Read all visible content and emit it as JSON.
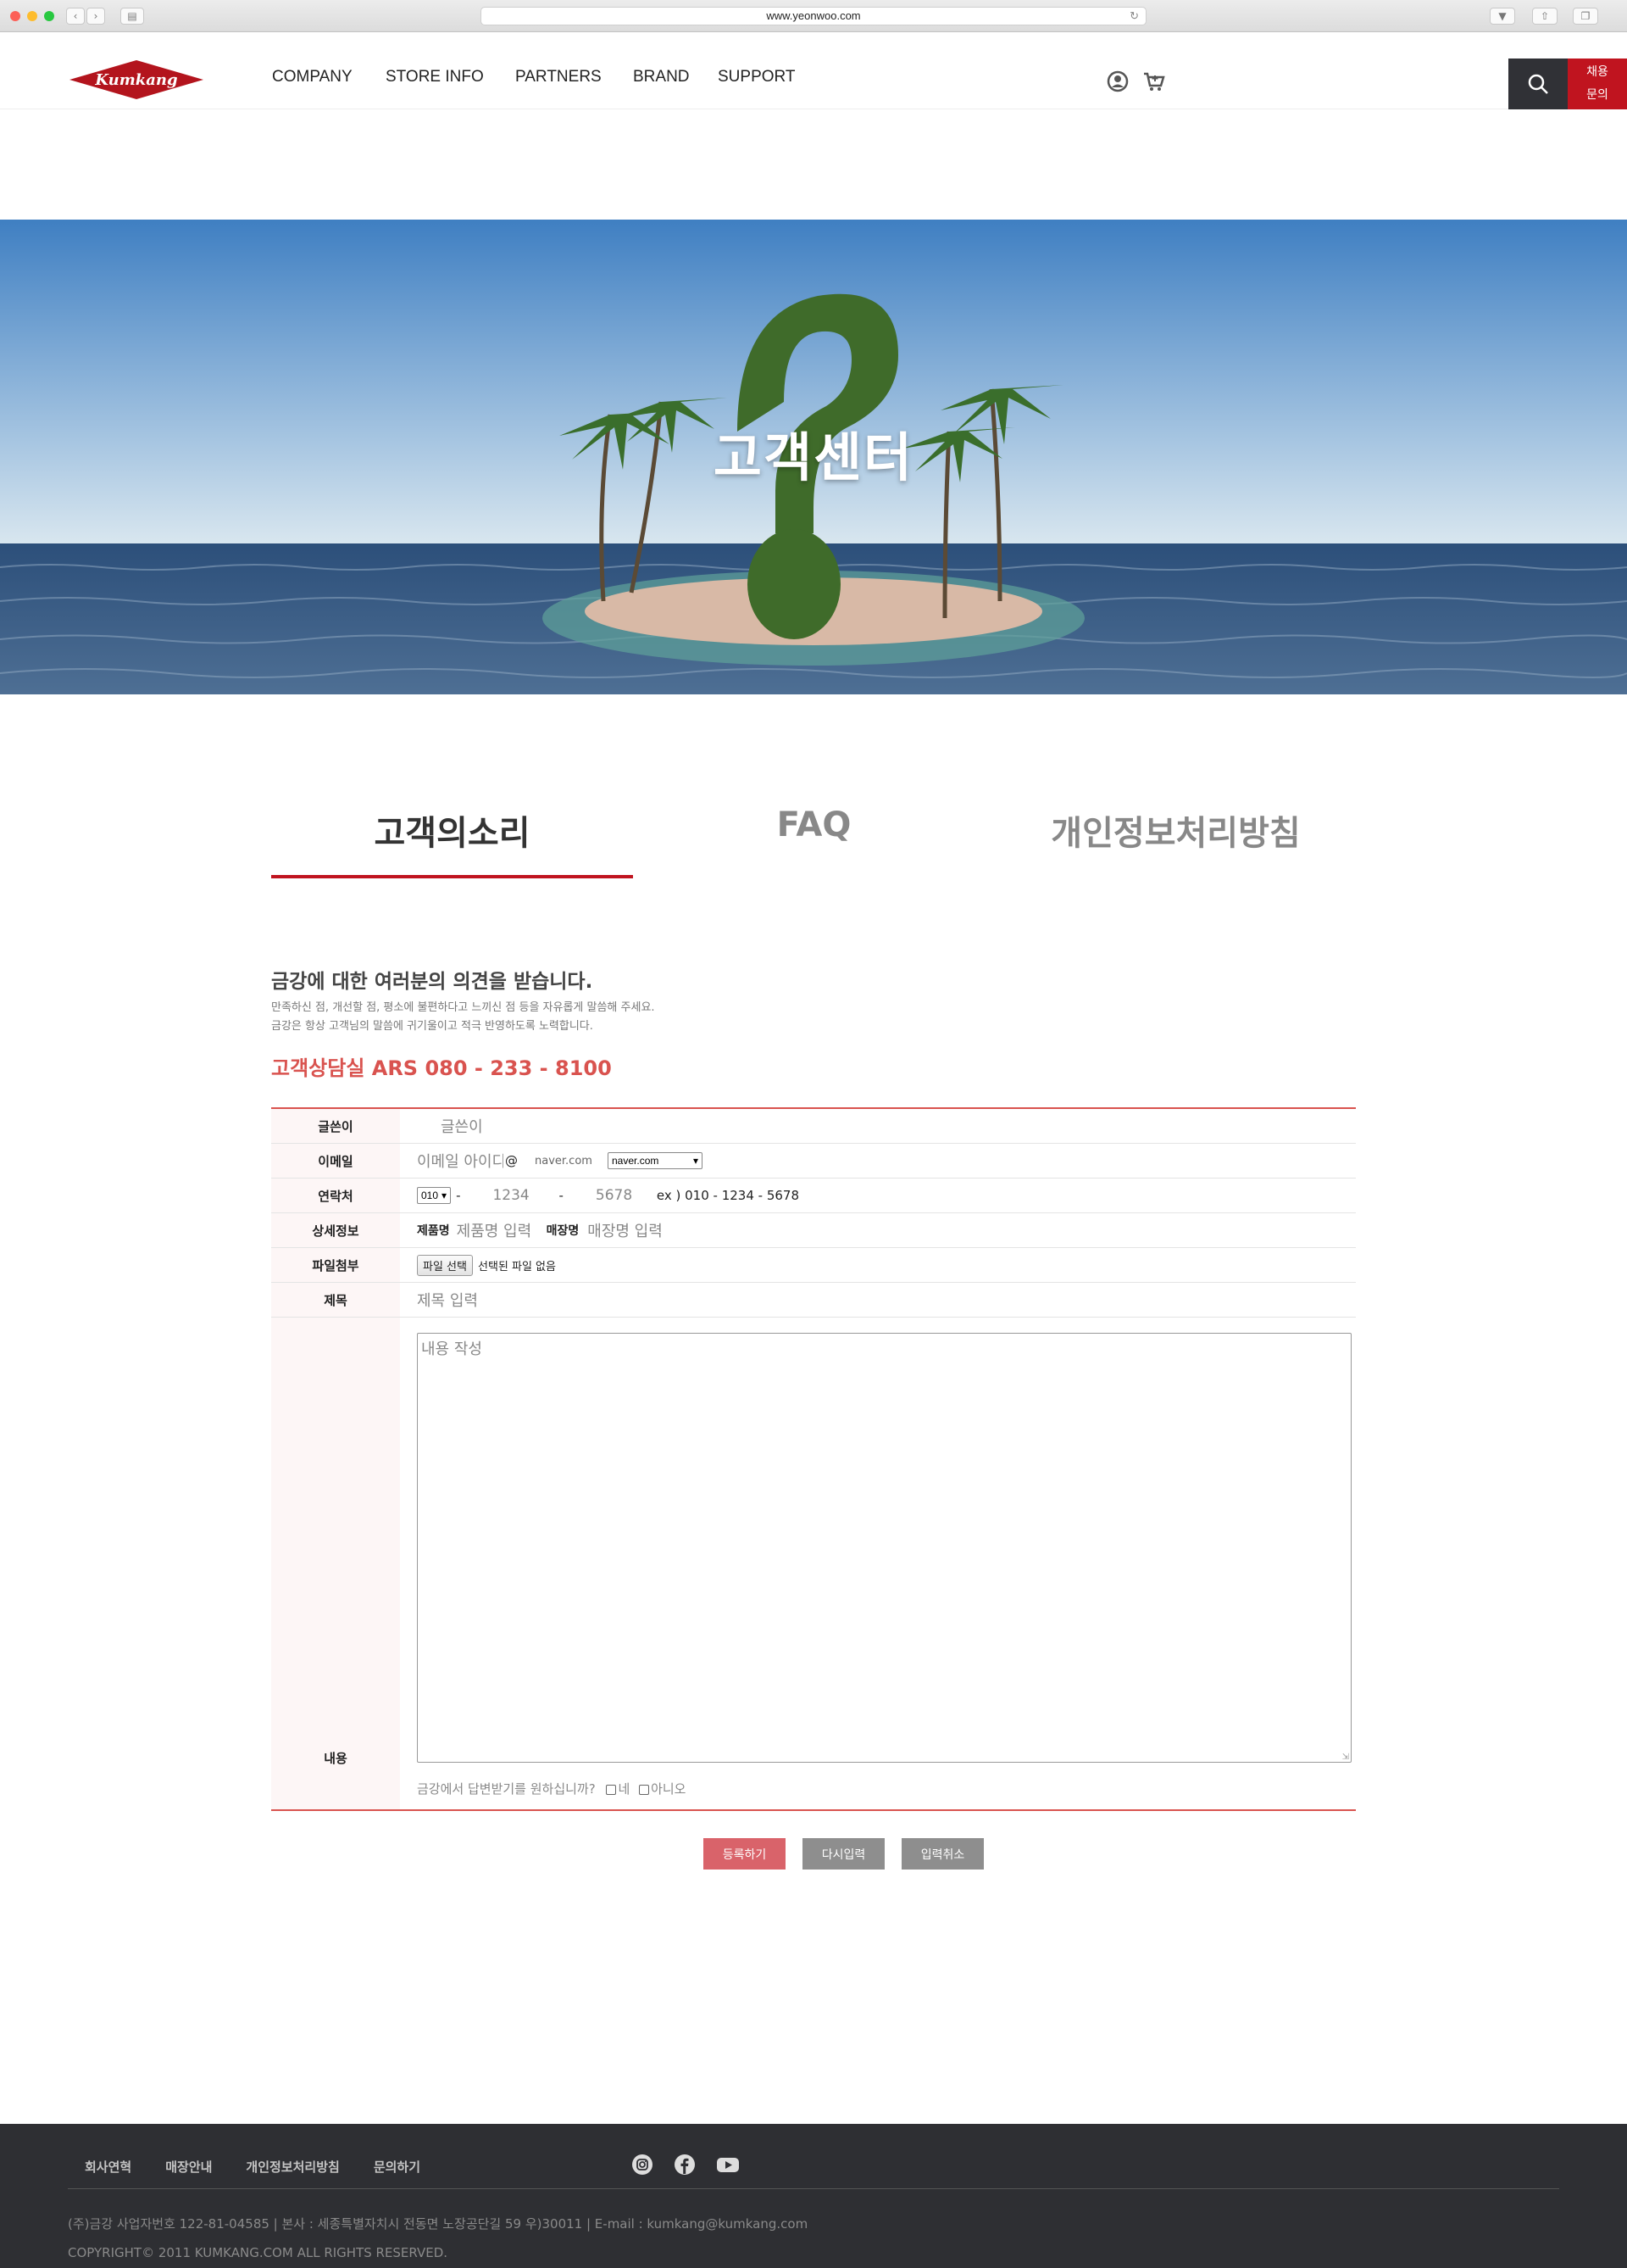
{
  "browser": {
    "url": "www.yeonwoo.com"
  },
  "header": {
    "logo_text": "Kumkang",
    "nav": [
      "COMPANY",
      "STORE INFO",
      "PARTNERS",
      "BRAND",
      "SUPPORT"
    ],
    "recruit_line1": "채용",
    "recruit_line2": "문의"
  },
  "hero": {
    "title": "고객센터"
  },
  "tabs": [
    "고객의소리",
    "FAQ",
    "개인정보처리방침"
  ],
  "intro": {
    "heading": "금강에 대한 여러분의 의견을 받습니다.",
    "line1": "만족하신 점, 개선할 점, 평소에 불편하다고 느끼신 점 등을 자유롭게 말씀해 주세요.",
    "line2": "금강은 항상 고객님의 말씀에 귀기울이고 적극 반영하도록 노력합니다.",
    "ars": "고객상담실 ARS 080 - 233 - 8100"
  },
  "form": {
    "writer_label": "글쓴이",
    "writer_placeholder": "글쓴이",
    "email_label": "이메일",
    "email_placeholder": "이메일 아이디",
    "email_at": "@",
    "email_domain_placeholder": "naver.com",
    "email_domain_select": "naver.com",
    "phone_label": "연락처",
    "phone_prefix": "010",
    "phone_dash": "-",
    "phone_mid_placeholder": "1234",
    "phone_last_placeholder": "5678",
    "phone_example": "ex ) 010 - 1234 - 5678",
    "detail_label": "상세정보",
    "product_label": "제품명",
    "product_placeholder": "제품명 입력",
    "store_label": "매장명",
    "store_placeholder": "매장명 입력",
    "file_label": "파일첨부",
    "file_button": "파일 선택",
    "file_status": "선택된 파일 없음",
    "title_label": "제목",
    "title_placeholder": "제목 입력",
    "content_label": "내용",
    "content_placeholder": "내용 작성",
    "reply_question": "금강에서 답변받기를 원하십니까?",
    "reply_yes": "네",
    "reply_no": "아니오"
  },
  "buttons": {
    "submit": "등록하기",
    "reset": "다시입력",
    "cancel": "입력취소",
    "submit_color": "#d9636a",
    "other_color": "#8e8e8e"
  },
  "footer": {
    "menu": [
      "회사연혁",
      "매장안내",
      "개인정보처리방침",
      "문의하기"
    ],
    "info": "(주)금강 사업자번호 122-81-04585 | 본사 : 세종특별자치시 전동면 노장공단길 59 우)30011 | E-mail : kumkang@kumkang.com",
    "copyright": "COPYRIGHT© 2011 KUMKANG.COM ALL RIGHTS RESERVED."
  },
  "colors": {
    "accent": "#c0141f",
    "ars": "#d9534f",
    "footer_bg": "#2e2f33"
  }
}
